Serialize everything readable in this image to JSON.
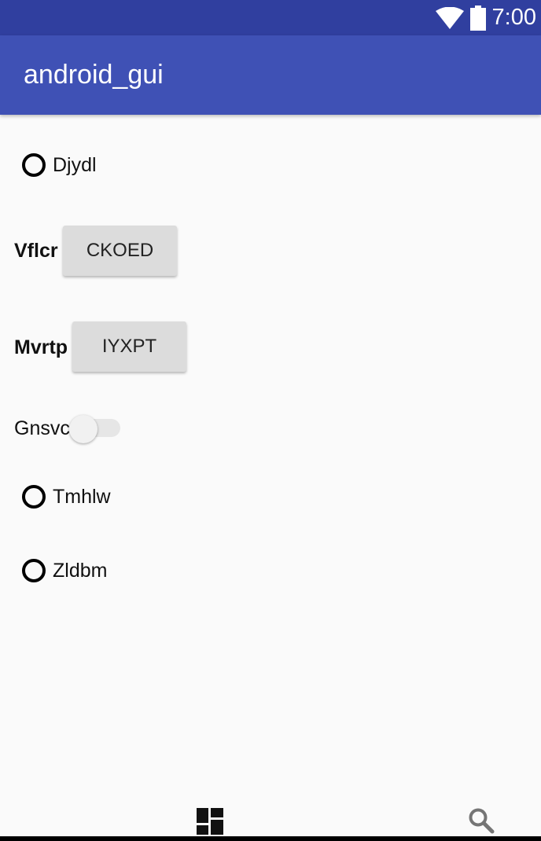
{
  "status_bar": {
    "time": "7:00",
    "icons": [
      "wifi-icon",
      "battery-icon"
    ]
  },
  "app_bar": {
    "title": "android_gui"
  },
  "content": {
    "radio_1": {
      "label": "Djydl",
      "checked": false
    },
    "row_vflcr": {
      "label": "Vflcr",
      "button": "CKOED"
    },
    "row_mvrtp": {
      "label": "Mvrtp",
      "button": "IYXPT"
    },
    "switch_row": {
      "label": "Gnsvc",
      "checked": false
    },
    "radio_2": {
      "label": "Tmhlw",
      "checked": false
    },
    "radio_3": {
      "label": "Zldbm",
      "checked": false
    }
  },
  "bottom_icons": [
    "dashboard-icon",
    "search-icon"
  ],
  "colors": {
    "status_bar": "#303f9f",
    "app_bar": "#3f51b5",
    "background": "#fafafa",
    "button": "#dcdcdc"
  }
}
